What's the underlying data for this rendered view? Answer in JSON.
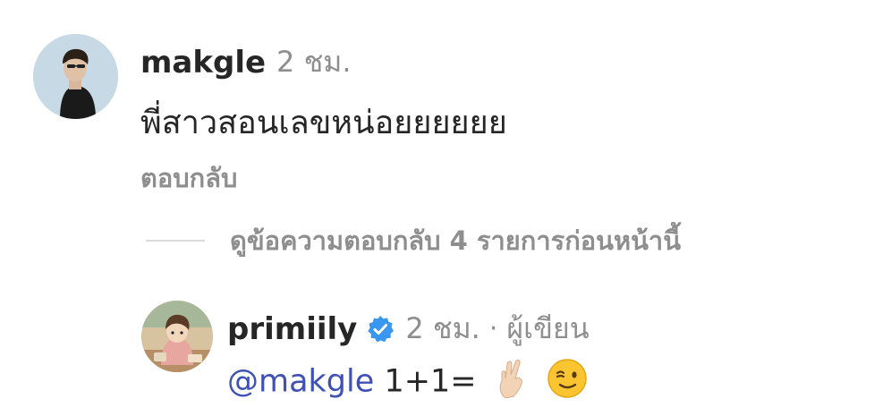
{
  "comment": {
    "username": "makgle",
    "time": "2 ชม.",
    "text": "พี่สาวสอนเลขหน่อยยยยยย",
    "reply_label": "ตอบกลับ",
    "view_replies_label": "ดูข้อความตอบกลับ 4 รายการก่อนหน้านี้"
  },
  "reply": {
    "username": "primiily",
    "verified": true,
    "time": "2 ชม.",
    "separator": "·",
    "author_label": "ผู้เขียน",
    "mention": "@makgle",
    "text": "1+1=",
    "emojis": [
      "crossed-fingers-icon",
      "winking-face-icon"
    ]
  },
  "colors": {
    "text_primary": "#262626",
    "text_secondary": "#8e8e8e",
    "mention": "#3f51b5",
    "verified_badge": "#3897f0",
    "divider": "#dbdbdb"
  }
}
